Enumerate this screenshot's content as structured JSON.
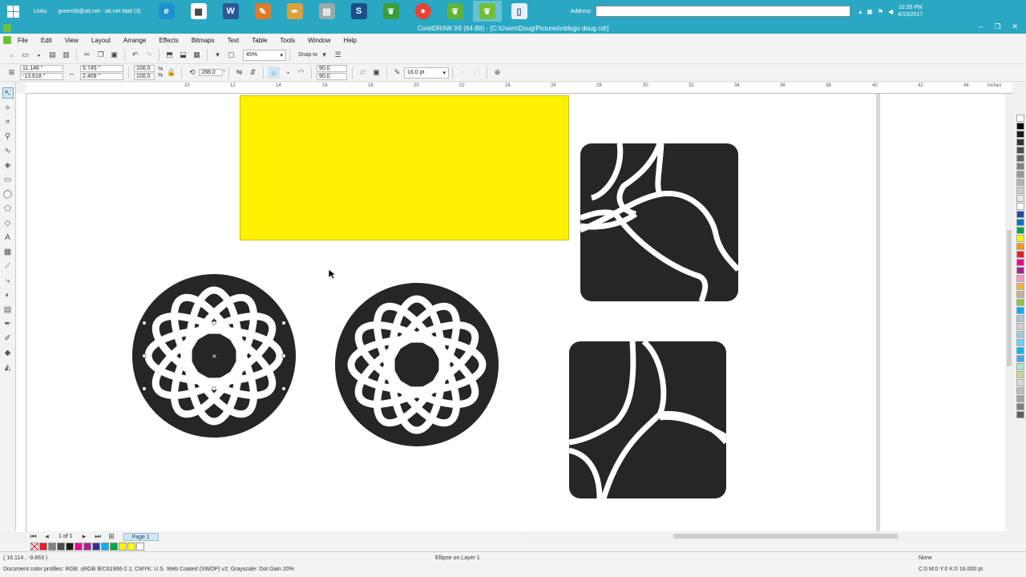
{
  "taskbar": {
    "links_label": "Links",
    "mail_label": "green58@att.net - att.net Mail (3)",
    "address_label": "Address",
    "clock_time": "10:35 PM",
    "clock_date": "4/15/2017"
  },
  "window": {
    "title": "CorelDRAW X6 (64-Bit) - [C:\\Users\\Doug\\Pictures\\nblogo doug.cdr]"
  },
  "menu": [
    "File",
    "Edit",
    "View",
    "Layout",
    "Arrange",
    "Effects",
    "Bitmaps",
    "Text",
    "Table",
    "Tools",
    "Window",
    "Help"
  ],
  "toolbar": {
    "zoom": "45%",
    "snap_to": "Snap to"
  },
  "property_bar": {
    "x": "11.146 \"",
    "y": "-13.618 \"",
    "width": "5.745 \"",
    "height": "2.409 \"",
    "scale_x": "100.0",
    "scale_y": "100.0",
    "percent": "%",
    "angle": "288.0",
    "start_angle": "90.0",
    "end_angle": "90.0",
    "outline_width": "16.0 pt"
  },
  "ruler": {
    "unit": "inches",
    "ticks": [
      "10",
      "12",
      "14",
      "16",
      "18",
      "20",
      "22",
      "24",
      "26",
      "28",
      "30",
      "32",
      "34",
      "36",
      "38",
      "40",
      "42",
      "44"
    ]
  },
  "page_nav": {
    "page_count": "1 of 1",
    "page_tab": "Page 1"
  },
  "status": {
    "coordinates": "( 16.114 , -9.863 )",
    "object": "Ellipse on Layer 1",
    "color_profile": "Document color profiles: RGB: sRGB IEC61966-2.1; CMYK: U.S. Web Coated (SWOP) v2; Grayscale: Dot Gain 20%",
    "fill": "None",
    "outline": "C:0 M:0 Y:0 K:0  16.000 pt"
  },
  "colors": {
    "taskbar": "#2aa7c2",
    "yellow": "#fff100",
    "shape": "#262626"
  },
  "palette_colors": [
    "#ffffff",
    "#000000",
    "#1a1a1a",
    "#333333",
    "#4d4d4d",
    "#666666",
    "#808080",
    "#999999",
    "#b3b3b3",
    "#cccccc",
    "#e6e6e6",
    "#ffffff",
    "#1f4e9c",
    "#0077c8",
    "#00a651",
    "#fff200",
    "#f7941d",
    "#ed1c24",
    "#ec008c",
    "#a3238e",
    "#f49ac1",
    "#fbb040",
    "#c7b299",
    "#8dc63f",
    "#00aeef",
    "#b0c4de",
    "#cfcfcf",
    "#9ec9e2",
    "#6dcff6",
    "#00b7eb",
    "#3fa9f5",
    "#a8e6cf",
    "#c8d89a",
    "#d9d9d9",
    "#bdbdbd",
    "#a0a0a0",
    "#7f7f7f",
    "#5e5e5e"
  ],
  "doc_palette": [
    "#ed1c24",
    "#808080",
    "#4d4d4d",
    "#1a1a1a",
    "#ec008c",
    "#a3238e",
    "#2e3192",
    "#00aeef",
    "#00a651",
    "#fff200",
    "#ffff00",
    "#ffffff"
  ]
}
